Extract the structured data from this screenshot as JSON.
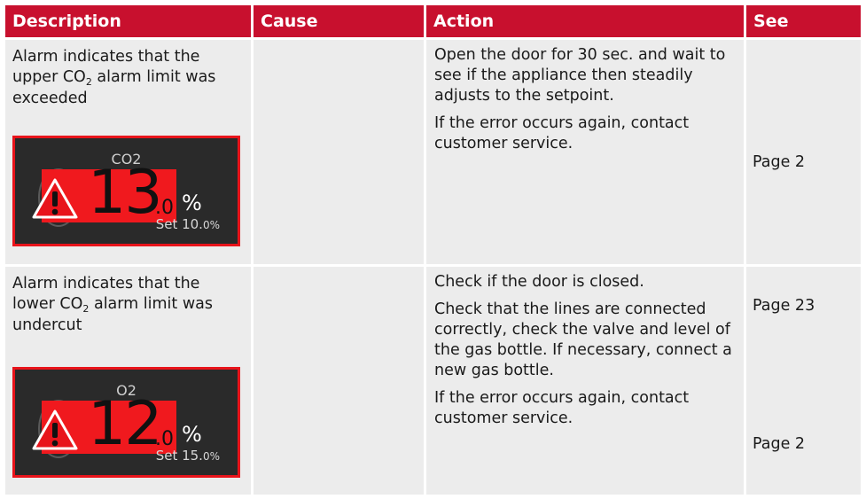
{
  "headers": {
    "description": "Description",
    "cause": "Cause",
    "action": "Action",
    "see": "See"
  },
  "rows": [
    {
      "description": {
        "before": "Alarm indicates that the upper CO",
        "sub": "2",
        "after": " alarm limit was exceeded"
      },
      "cause": "",
      "actions": [
        "Open the door for 30 sec. and wait to see if the appliance then steadily adjusts to the setpoint.",
        "If the error occurs again, contact customer service."
      ],
      "see": [
        "Page 2"
      ],
      "display": {
        "label": "CO2",
        "value_int": "13",
        "value_dec": ".0",
        "unit": "%",
        "set_prefix": "Set 10.",
        "set_suffix": "0%"
      }
    },
    {
      "description": {
        "before": "Alarm indicates that the lower CO",
        "sub": "2",
        "after": " alarm limit was undercut"
      },
      "cause": "",
      "actions": [
        "Check if the door is closed.",
        "Check that the lines are connected correctly, check the valve and level of the gas bottle.  If necessary, connect a new gas bottle.",
        "If the error occurs again, contact customer service."
      ],
      "see": [
        "Page 23",
        "Page 2"
      ],
      "display": {
        "label": "O2",
        "value_int": "12",
        "value_dec": ".0",
        "unit": "%",
        "set_prefix": "Set 15.",
        "set_suffix": "0%"
      }
    }
  ],
  "colors": {
    "header": "#c8102e",
    "cell": "#ececec",
    "alarm": "#f0191e",
    "display_bg": "#2a2a2a"
  }
}
